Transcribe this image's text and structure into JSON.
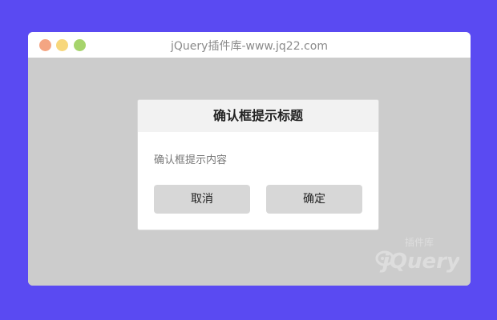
{
  "window": {
    "title": "jQuery插件库-www.jq22.com"
  },
  "dialog": {
    "title": "确认框提示标题",
    "message": "确认框提示内容",
    "cancel_label": "取消",
    "confirm_label": "确定"
  },
  "watermark": {
    "top_text": "插件库",
    "main_text": "jQuery"
  }
}
